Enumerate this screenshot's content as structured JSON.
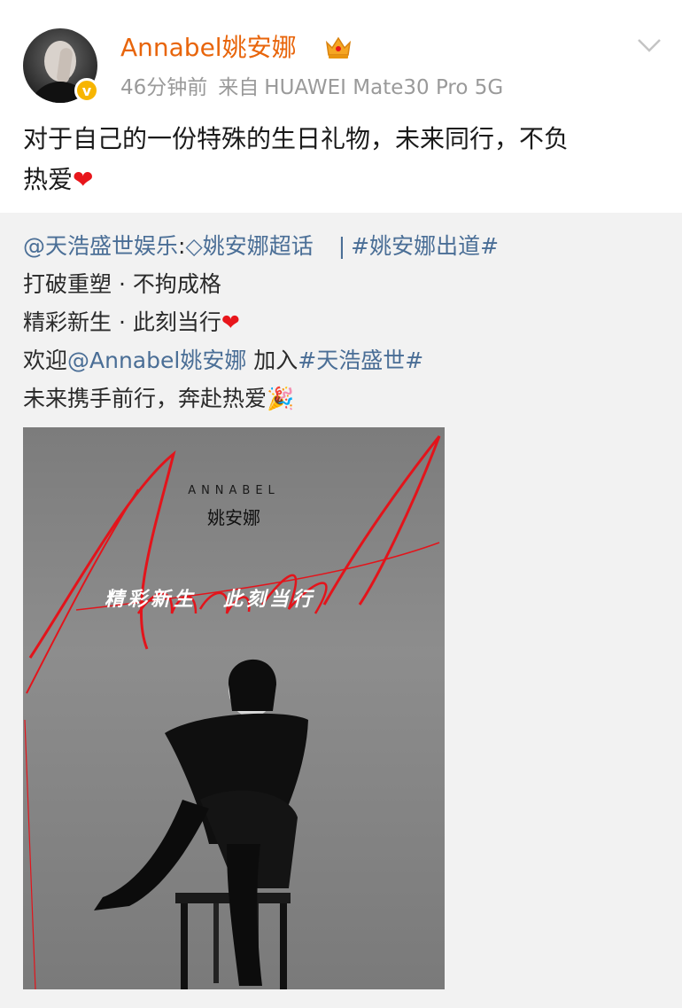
{
  "post": {
    "username": "Annabel姚安娜",
    "time": "46分钟前",
    "from_label": "来自",
    "device": "HUAWEI Mate30 Pro 5G",
    "text_line1": "对于自己的一份特殊的生日礼物，未来同行，不负",
    "text_line2": "热爱",
    "heart_icon": "red-heart-icon"
  },
  "repost": {
    "author": "@天浩盛世娱乐",
    "colon": ":",
    "supertopic": "姚安娜超话",
    "separator": "|",
    "hashtag1": "#姚安娜出道#",
    "line2": "打破重塑 · 不拘成格",
    "line3": "精彩新生 · 此刻当行",
    "line4_prefix": "欢迎",
    "line4_mention": "@Annabel姚安娜",
    "line4_mid": " 加入",
    "line4_hashtag": "#天浩盛世#",
    "line5": "未来携手前行，奔赴热爱",
    "party_icon": "party-popper-icon"
  },
  "poster": {
    "name_en": "ANNABEL",
    "name_cn": "姚安娜",
    "slogan_a": "精彩新生",
    "slogan_b": "此刻当行",
    "script_word": "Annabel"
  },
  "colors": {
    "username": "#e8650b",
    "link": "#4a6e96",
    "heart": "#e8161b",
    "poster_script": "#e3141b"
  }
}
